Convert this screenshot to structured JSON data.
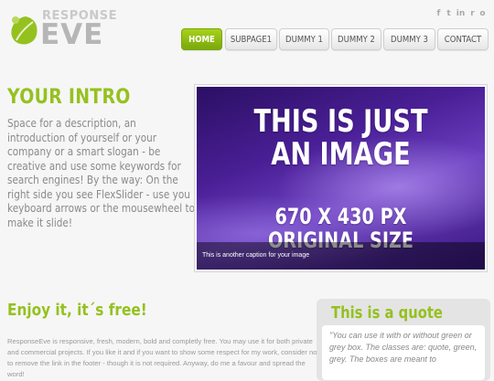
{
  "logo": {
    "top_text": "RESPONSE",
    "main_text": "EVE",
    "leaf_color": "#95c11f"
  },
  "social": [
    {
      "icon": "facebook-icon",
      "glyph": "f"
    },
    {
      "icon": "twitter-icon",
      "glyph": "t"
    },
    {
      "icon": "linkedin-icon",
      "glyph": "in"
    },
    {
      "icon": "rss-icon",
      "glyph": "r"
    },
    {
      "icon": "flickr-icon",
      "glyph": "o"
    }
  ],
  "nav": {
    "items": [
      {
        "label": "HOME",
        "active": true
      },
      {
        "label": "SUBPAGE1",
        "active": false
      },
      {
        "label": "DUMMY 1",
        "active": false
      },
      {
        "label": "DUMMY 2",
        "active": false
      },
      {
        "label": "DUMMY 3",
        "active": false
      },
      {
        "label": "CONTACT",
        "active": false
      }
    ]
  },
  "intro": {
    "title": "YOUR INTRO",
    "text": "Space for a description, an introduction of yourself or your company or a smart slogan - be creative and use some keywords for search engines! By the way: On the right side you see FlexSlider - use you keyboard arrows or the mousewheel to make it slide!"
  },
  "slider": {
    "line1": "THIS IS JUST",
    "line2": "AN IMAGE",
    "line3": "670 X 430 PX",
    "line4": "ORIGINAL SIZE",
    "caption": "This is another caption for your image"
  },
  "enjoy": {
    "title": "Enjoy it, it´s free!",
    "text": "ResponseEve is responsive, fresh, modern, bold and completly free. You may use it for both private and commercial projects. If you like it and if you want to show some respect for my work, consider not to remove the link in the footer - though it is not required. Anyway, do me a favour and spread the word!"
  },
  "quote": {
    "title": "This is a quote",
    "text": "\"You can use it with or without green or grey box. The classes are: quote, green, grey. The boxes are meant to"
  },
  "colors": {
    "accent": "#95c11f",
    "text": "#888888",
    "background": "#f6f6f6"
  }
}
